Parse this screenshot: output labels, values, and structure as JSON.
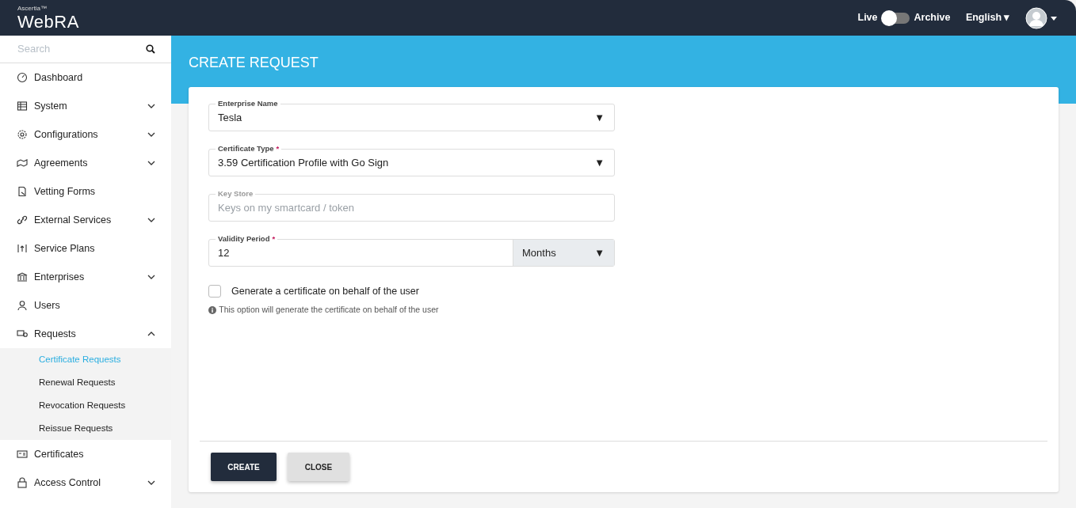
{
  "header": {
    "brand_small": "Ascertia™",
    "brand": "WebRA",
    "toggle_left": "Live",
    "toggle_right": "Archive",
    "archive_on": false,
    "language": "English",
    "language_arrow": "▾"
  },
  "sidebar": {
    "search": {
      "placeholder": "Search"
    },
    "items": [
      {
        "label": "Dashboard",
        "selected": false
      },
      {
        "label": "System",
        "expanded": false,
        "selected": false
      },
      {
        "label": "Configurations",
        "expanded": false,
        "selected": false
      },
      {
        "label": "Agreements",
        "expanded": false,
        "selected": false
      },
      {
        "label": "Vetting Forms",
        "selected": false
      },
      {
        "label": "External Services",
        "expanded": false,
        "selected": false
      },
      {
        "label": "Service Plans",
        "selected": false
      },
      {
        "label": "Enterprises",
        "expanded": false,
        "selected": false
      },
      {
        "label": "Users",
        "selected": false
      },
      {
        "label": "Requests",
        "expanded": true,
        "selected": false,
        "children": [
          {
            "label": "Certificate Requests",
            "selected": true
          },
          {
            "label": "Renewal Requests",
            "selected": false
          },
          {
            "label": "Revocation Requests",
            "selected": false
          },
          {
            "label": "Reissue Requests",
            "selected": false
          }
        ]
      },
      {
        "label": "Certificates",
        "selected": false
      },
      {
        "label": "Access Control",
        "expanded": false,
        "selected": false
      }
    ]
  },
  "page_title": "CREATE REQUEST",
  "form": {
    "fields": [
      {
        "kind": "select",
        "label": "Enterprise Name",
        "disabled": false,
        "value": "Tesla",
        "arrow": "▼"
      },
      {
        "kind": "select",
        "label": "Certificate Type",
        "required_mark": "*",
        "disabled": false,
        "value": "3.59 Certification Profile with Go Sign",
        "arrow": "▼"
      },
      {
        "kind": "input",
        "label": "Key Store",
        "disabled": true,
        "placeholder": "Keys on my smartcard / token"
      },
      {
        "kind": "input-unit",
        "label": "Validity Period",
        "required_mark": "*",
        "disabled": false,
        "value": "12",
        "unit": "Months",
        "arrow": "▼"
      }
    ],
    "checkbox": {
      "label": "Generate a certificate on behalf of the user",
      "checked": false
    },
    "hint": "This option will generate the certificate on behalf of the user",
    "buttons": [
      {
        "label": "CREATE",
        "kind": "primary"
      },
      {
        "label": "CLOSE",
        "kind": "secondary"
      }
    ]
  }
}
